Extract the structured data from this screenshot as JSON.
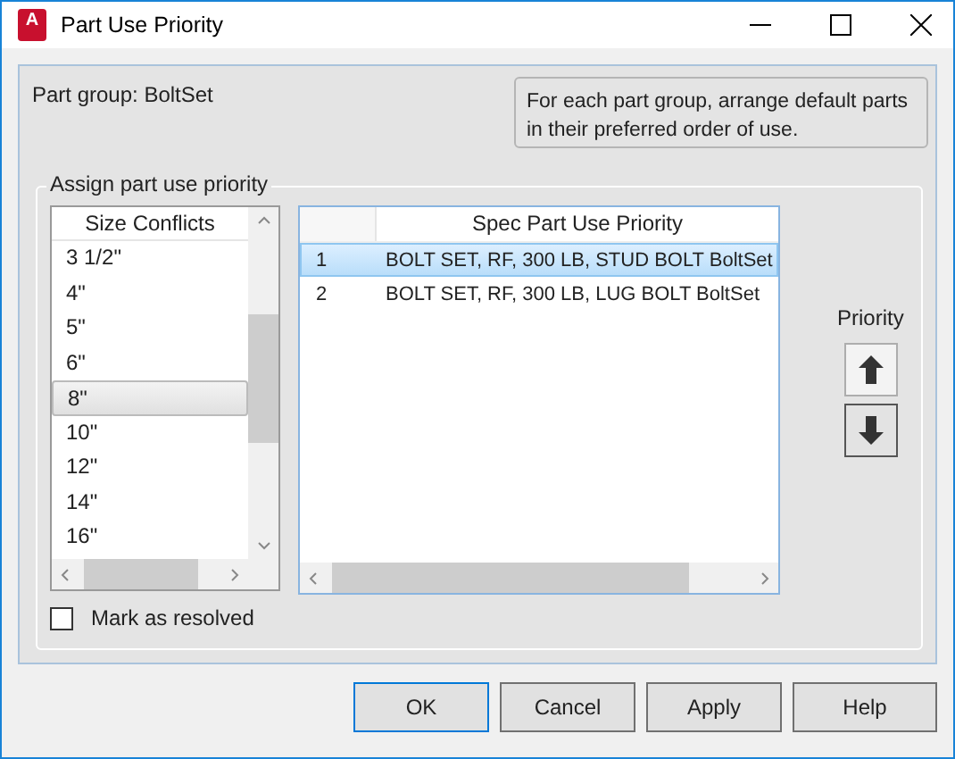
{
  "window": {
    "title": "Part Use Priority",
    "icon_letter": "A"
  },
  "part_group_label": "Part group: BoltSet",
  "info_text": "For each part group, arrange default parts in their preferred order of use.",
  "group_title": "Assign part use priority",
  "size_list": {
    "header": "Size Conflicts",
    "items": [
      {
        "label": "3 1/2\"",
        "selected": false
      },
      {
        "label": "4\"",
        "selected": false
      },
      {
        "label": "5\"",
        "selected": false
      },
      {
        "label": "6\"",
        "selected": false
      },
      {
        "label": "8\"",
        "selected": true
      },
      {
        "label": "10\"",
        "selected": false
      },
      {
        "label": "12\"",
        "selected": false
      },
      {
        "label": "14\"",
        "selected": false
      },
      {
        "label": "16\"",
        "selected": false
      }
    ]
  },
  "priority_grid": {
    "header": "Spec Part Use Priority",
    "rows": [
      {
        "index": "1",
        "part": "BOLT SET, RF, 300 LB, STUD BOLT BoltSet",
        "selected": true
      },
      {
        "index": "2",
        "part": "BOLT SET, RF, 300 LB, LUG BOLT BoltSet",
        "selected": false
      }
    ]
  },
  "priority_label": "Priority",
  "mark_as_resolved": {
    "label": "Mark as resolved",
    "checked": false
  },
  "buttons": [
    "OK",
    "Cancel",
    "Apply",
    "Help"
  ]
}
